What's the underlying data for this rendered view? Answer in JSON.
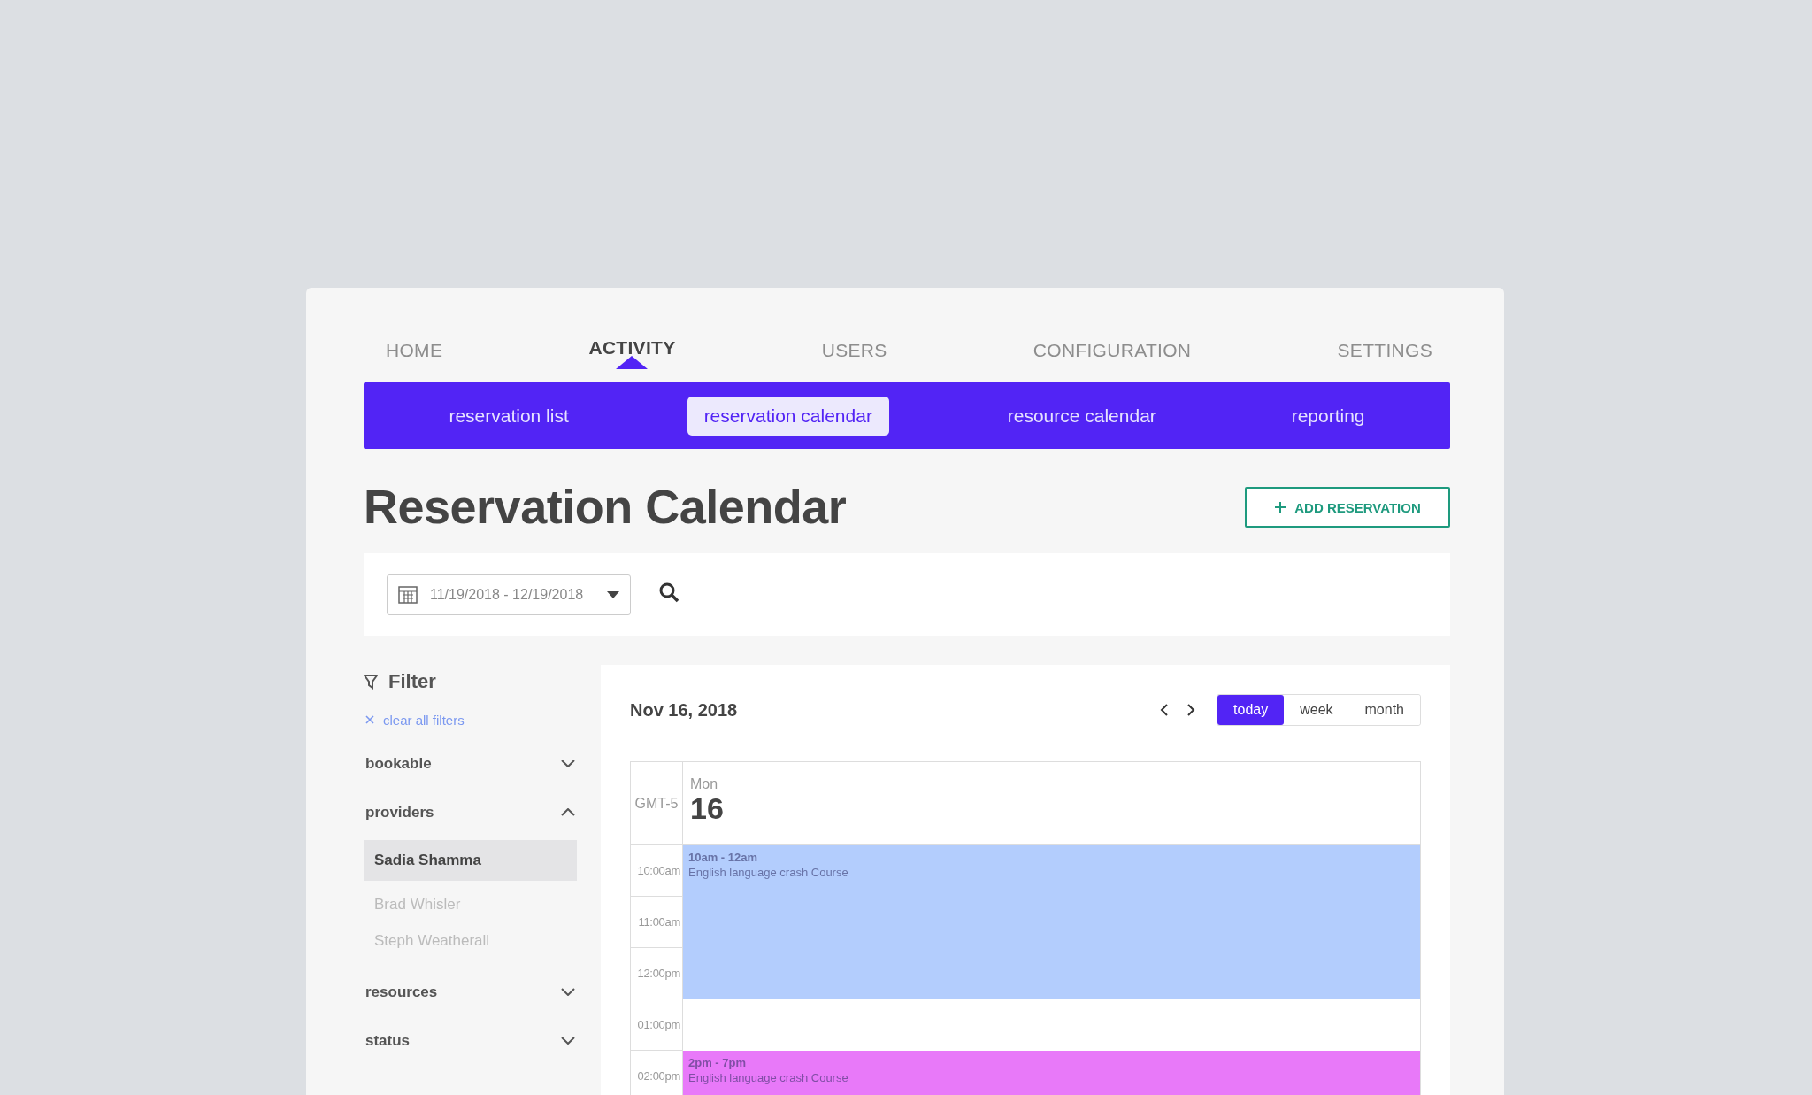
{
  "main_nav": [
    {
      "label": "HOME",
      "selected": false
    },
    {
      "label": "ACTIVITY",
      "selected": true
    },
    {
      "label": "USERS",
      "selected": false
    },
    {
      "label": "CONFIGURATION",
      "selected": false
    },
    {
      "label": "SETTINGS",
      "selected": false
    }
  ],
  "sub_nav": [
    {
      "label": "reservation list",
      "selected": false
    },
    {
      "label": "reservation calendar",
      "selected": true
    },
    {
      "label": "resource calendar",
      "selected": false
    },
    {
      "label": "reporting",
      "selected": false
    }
  ],
  "page_title": "Reservation Calendar",
  "add_button": "ADD RESERVATION",
  "date_range": "11/19/2018 - 12/19/2018",
  "filter": {
    "title": "Filter",
    "clear_link": "clear all filters",
    "sections": [
      {
        "label": "bookable",
        "expanded": false
      },
      {
        "label": "providers",
        "expanded": true,
        "items": [
          {
            "label": "Sadia Shamma",
            "selected": true
          },
          {
            "label": "Brad Whisler",
            "selected": false
          },
          {
            "label": "Steph Weatherall",
            "selected": false
          }
        ]
      },
      {
        "label": "resources",
        "expanded": false
      },
      {
        "label": "status",
        "expanded": false
      }
    ]
  },
  "calendar": {
    "date_label": "Nov 16, 2018",
    "views": [
      {
        "label": "today",
        "selected": true
      },
      {
        "label": "week",
        "selected": false
      },
      {
        "label": "month",
        "selected": false
      }
    ],
    "timezone": "GMT-5",
    "day_name": "Mon",
    "day_number": "16",
    "blocks": [
      {
        "kind": "event",
        "time": "10am - 12am",
        "title": "English language crash Course",
        "color": "#b3cdfd",
        "hours": [
          "10:00am",
          "11:00am",
          "12:00pm"
        ]
      },
      {
        "kind": "free",
        "hours": [
          "01:00pm"
        ]
      },
      {
        "kind": "event",
        "time": "2pm - 7pm",
        "title": "English language crash Course",
        "color": "#e879f9",
        "hours": [
          "02:00pm"
        ]
      }
    ]
  }
}
